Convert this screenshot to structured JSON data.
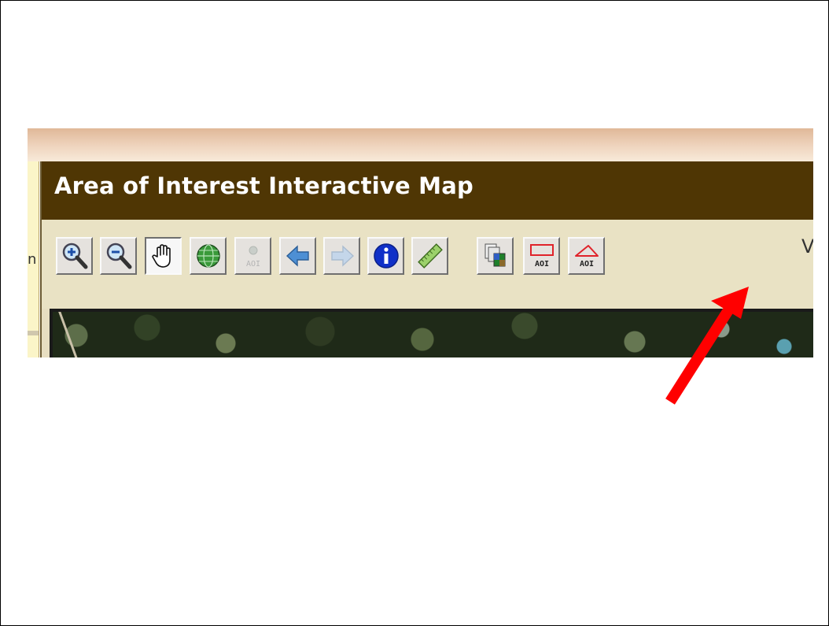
{
  "window": {
    "title": "Area of Interest Interactive Map",
    "left_peek_text": "n",
    "overflow_text": "V"
  },
  "toolbar": {
    "buttons": [
      {
        "name": "zoom-in",
        "icon": "magnifier-plus-icon",
        "label": "",
        "enabled": true,
        "pressed": false
      },
      {
        "name": "zoom-out",
        "icon": "magnifier-minus-icon",
        "label": "",
        "enabled": true,
        "pressed": false
      },
      {
        "name": "pan",
        "icon": "hand-icon",
        "label": "",
        "enabled": true,
        "pressed": true
      },
      {
        "name": "full-extent",
        "icon": "globe-icon",
        "label": "",
        "enabled": true,
        "pressed": false
      },
      {
        "name": "zoom-to-aoi",
        "icon": "aoi-point-icon",
        "label": "AOI",
        "enabled": false,
        "pressed": false
      },
      {
        "name": "back",
        "icon": "arrow-left-icon",
        "label": "",
        "enabled": true,
        "pressed": false
      },
      {
        "name": "forward",
        "icon": "arrow-right-icon",
        "label": "",
        "enabled": false,
        "pressed": false
      },
      {
        "name": "identify",
        "icon": "info-icon",
        "label": "",
        "enabled": true,
        "pressed": false
      },
      {
        "name": "measure",
        "icon": "ruler-icon",
        "label": "",
        "enabled": true,
        "pressed": false
      },
      {
        "name": "layers",
        "icon": "layers-icon",
        "label": "",
        "enabled": true,
        "pressed": false
      },
      {
        "name": "aoi-rectangle",
        "icon": "aoi-rectangle-icon",
        "label": "AOI",
        "enabled": true,
        "pressed": false
      },
      {
        "name": "aoi-polygon",
        "icon": "aoi-polygon-icon",
        "label": "AOI",
        "enabled": true,
        "pressed": false
      }
    ]
  },
  "annotation": {
    "color": "#ff0000",
    "target": "aoi-polygon"
  },
  "colors": {
    "titlebar": "#4f3604",
    "panel": "#e9e2c4",
    "button_face": "#e5e2de",
    "arrow": "#ff0000"
  }
}
